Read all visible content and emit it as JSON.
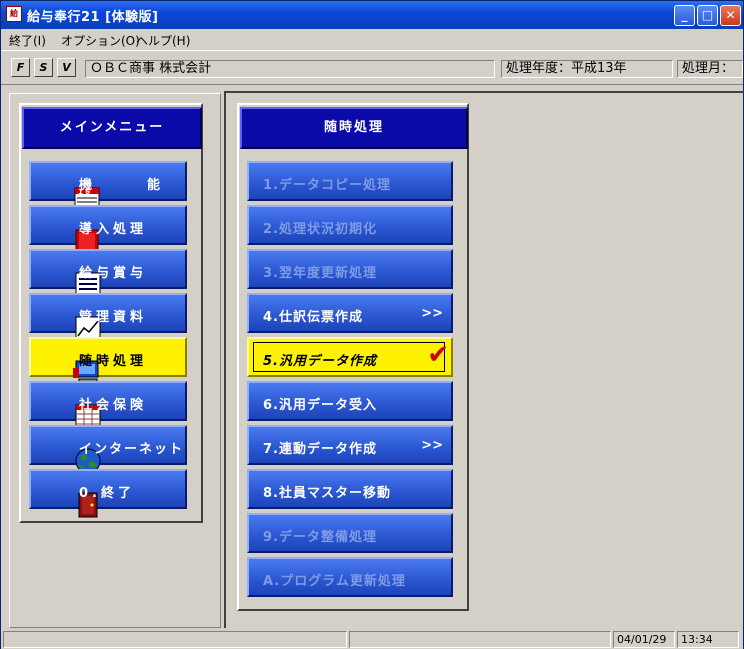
{
  "window": {
    "title": "給与奉行21 [体験版]",
    "app_icon_text": "給",
    "controls": {
      "minimize": "_",
      "maximize": "□",
      "close": "✕"
    }
  },
  "menubar": {
    "items": [
      "終了(I)",
      "オプション(O)",
      "ヘルプ(H)"
    ]
  },
  "toolbar": {
    "f_label": "F",
    "s_label": "S",
    "v_label": "V",
    "company": "ＯＢＣ商事 株式会計",
    "fiscal_year": "処理年度：平成13年",
    "month_label": "処理月："
  },
  "main_menu": {
    "title": "メインメニュー",
    "items": [
      {
        "label": "機　　　能",
        "icon": "calendar-icon"
      },
      {
        "label": "導入処理",
        "icon": "book-icon"
      },
      {
        "label": "給与賞与",
        "icon": "document-icon"
      },
      {
        "label": "管理資料",
        "icon": "chart-icon"
      },
      {
        "label": "随時処理",
        "icon": "computer-icon",
        "active": true
      },
      {
        "label": "社会保険",
        "icon": "table-icon"
      },
      {
        "label": "インターネット",
        "icon": "globe-icon"
      },
      {
        "label": "0.終了",
        "icon": "exit-door-icon"
      }
    ]
  },
  "sub_menu": {
    "title": "随時処理",
    "items": [
      {
        "label": "1.データコピー処理",
        "enabled": false
      },
      {
        "label": "2.処理状況初期化",
        "enabled": false
      },
      {
        "label": "3.翌年度更新処理",
        "enabled": false
      },
      {
        "label": "4.仕訳伝票作成",
        "enabled": true,
        "chevron": ">>"
      },
      {
        "label": "5.汎用データ作成",
        "enabled": true,
        "active": true,
        "check": "✔"
      },
      {
        "label": "6.汎用データ受入",
        "enabled": true
      },
      {
        "label": "7.連動データ作成",
        "enabled": true,
        "chevron": ">>"
      },
      {
        "label": "8.社員マスター移動",
        "enabled": true
      },
      {
        "label": "9.データ整備処理",
        "enabled": false
      },
      {
        "label": "A.プログラム更新処理",
        "enabled": false
      }
    ]
  },
  "statusbar": {
    "date": "04/01/29",
    "time": "13:34"
  }
}
